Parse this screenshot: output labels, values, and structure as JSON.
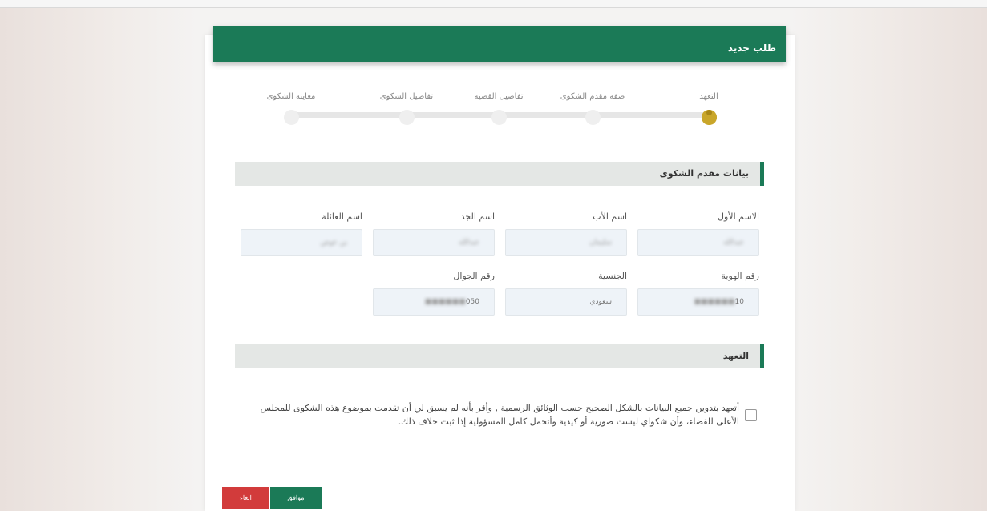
{
  "header": {
    "title": "طلب جديد"
  },
  "stepper": {
    "steps": [
      {
        "label": "التعهد",
        "active": true
      },
      {
        "label": "صفة مقدم الشكوى",
        "active": false
      },
      {
        "label": "تفاصيل القضية",
        "active": false
      },
      {
        "label": "تفاصيل الشكوى",
        "active": false
      },
      {
        "label": "معاينة الشكوى",
        "active": false
      }
    ],
    "active_color": "#c9a62a"
  },
  "applicant": {
    "section_title": "بيانات مقدم الشكوى",
    "first_name": {
      "label": "الاسم الأول",
      "value": "عبدالله"
    },
    "father_name": {
      "label": "اسم الأب",
      "value": "سليمان"
    },
    "grandfather_name": {
      "label": "اسم الجد",
      "value": "عبدالله"
    },
    "family_name": {
      "label": "اسم العائلة",
      "value": "بن عوض"
    },
    "id_number": {
      "label": "رقم الهوية",
      "value": "10"
    },
    "nationality": {
      "label": "الجنسية",
      "value": "سعودي"
    },
    "mobile": {
      "label": "رقم الجوال",
      "value": "050"
    }
  },
  "pledge": {
    "section_title": "التعهد",
    "text": "أتعهد بتدوين جميع البيانات بالشكل الصحيح حسب الوثائق الرسمية , وأقر بأنه لم يسبق لي أن تقدمت بموضوع هذه الشكوى للمجلس الأعلى للقضاء، وأن شكواي ليست صورية أو كيدية وأتحمل كامل المسؤولية إذا ثبت خلاف ذلك.",
    "checked": false
  },
  "actions": {
    "ok_label": "موافق",
    "cancel_label": "الغاء"
  },
  "colors": {
    "brand": "#1b7a57",
    "danger": "#d23b3b"
  }
}
